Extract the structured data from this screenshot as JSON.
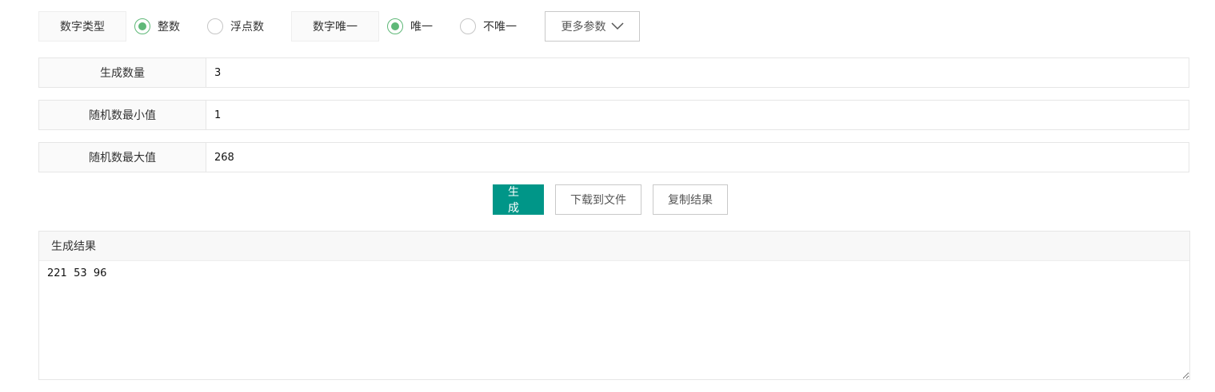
{
  "options": {
    "number_type_label": "数字类型",
    "number_type_options": [
      {
        "label": "整数",
        "checked": true
      },
      {
        "label": "浮点数",
        "checked": false
      }
    ],
    "unique_label": "数字唯一",
    "unique_options": [
      {
        "label": "唯一",
        "checked": true
      },
      {
        "label": "不唯一",
        "checked": false
      }
    ],
    "more_params_label": "更多参数"
  },
  "fields": {
    "count_label": "生成数量",
    "count_value": "3",
    "min_label": "随机数最小值",
    "min_value": "1",
    "max_label": "随机数最大值",
    "max_value": "268"
  },
  "actions": {
    "generate_label": "生成",
    "download_label": "下载到文件",
    "copy_label": "复制结果"
  },
  "result": {
    "title": "生成结果",
    "value": "221  53  96"
  },
  "colors": {
    "primary": "#009688",
    "radio_checked": "#5fb878"
  },
  "icons": {
    "more_params": "chevron-down-icon"
  }
}
